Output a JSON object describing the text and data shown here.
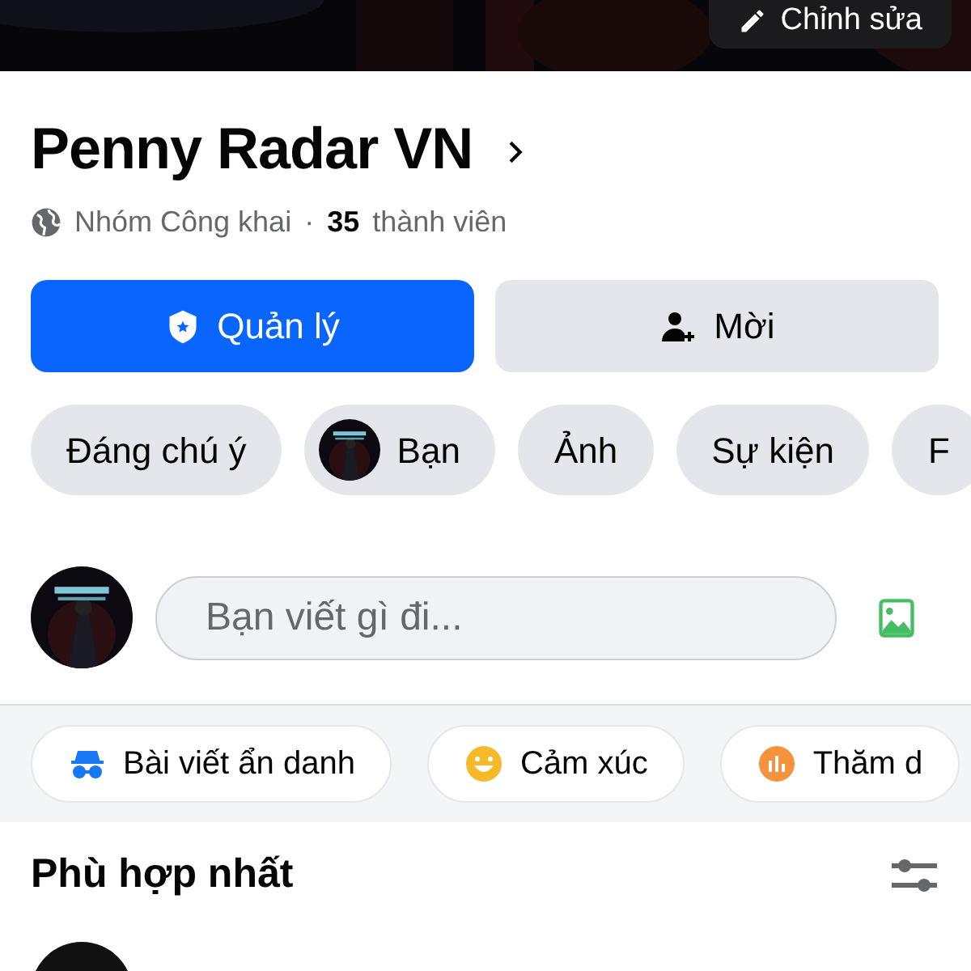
{
  "cover": {
    "kind": "picture",
    "edit_button": "Chỉnh sửa"
  },
  "group": {
    "name": "Penny Radar VN",
    "privacy": "Nhóm Công khai",
    "separator": "·",
    "member_count": "35",
    "member_label": "thành viên"
  },
  "actions": [
    {
      "label": "Quản lý",
      "kind": "primary"
    },
    {
      "label": "Mời",
      "kind": "secondary"
    }
  ],
  "tabs": [
    {
      "label": "Đáng chú ý",
      "kind": "text"
    },
    {
      "label": "Bạn",
      "kind": "avatar"
    },
    {
      "label": "Ảnh",
      "kind": "text"
    },
    {
      "label": "Sự kiện",
      "kind": "text"
    },
    {
      "label": "F",
      "kind": "text"
    }
  ],
  "composer": {
    "placeholder": "Bạn viết gì đi..."
  },
  "post_options": [
    {
      "label": "Bài viết ẩn danh",
      "kind": "anonymous"
    },
    {
      "label": "Cảm xúc",
      "kind": "feeling"
    },
    {
      "label": "Thăm d",
      "kind": "poll"
    }
  ],
  "feed": {
    "sort_label": "Phù hợp nhất"
  }
}
